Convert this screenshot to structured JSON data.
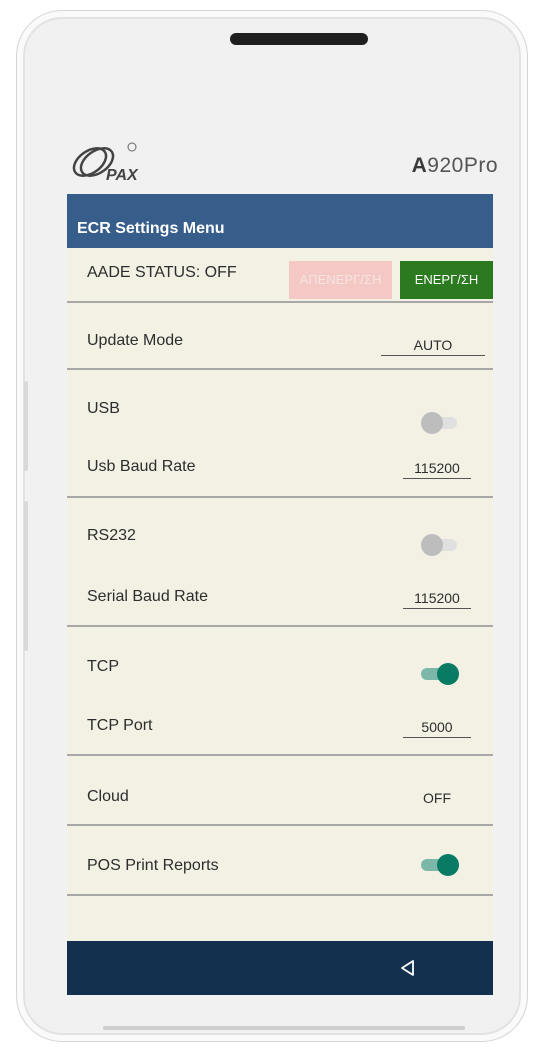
{
  "device": {
    "brand": "PAX",
    "model_bold": "A",
    "model_rest": "920Pro"
  },
  "screen": {
    "title": "ECR Settings Menu",
    "aade": {
      "label": "AADE STATUS: OFF",
      "deactivate_label": "ΑΠΕΝΕΡΓ/ΣΗ",
      "activate_label": "ΕΝΕΡΓ/ΣΗ"
    },
    "update_mode": {
      "label": "Update Mode",
      "value": "AUTO"
    },
    "usb": {
      "label": "USB",
      "enabled": false,
      "baud_label": "Usb Baud Rate",
      "baud_value": "115200"
    },
    "rs232": {
      "label": "RS232",
      "enabled": false,
      "baud_label": "Serial Baud Rate",
      "baud_value": "115200"
    },
    "tcp": {
      "label": "TCP",
      "enabled": true,
      "port_label": "TCP Port",
      "port_value": "5000"
    },
    "cloud": {
      "label": "Cloud",
      "value": "OFF"
    },
    "pos_print_reports": {
      "label": "POS Print Reports",
      "enabled": true
    }
  },
  "navbar": {
    "back_icon": "triangle-back-icon"
  },
  "colors": {
    "title_bar": "#375e8a",
    "screen_bg": "#f3f0e4",
    "activate_green": "#2b7a1f",
    "deactivate_pink": "#f4c8c4",
    "toggle_on": "#097a63",
    "nav_bar": "#14304f"
  }
}
